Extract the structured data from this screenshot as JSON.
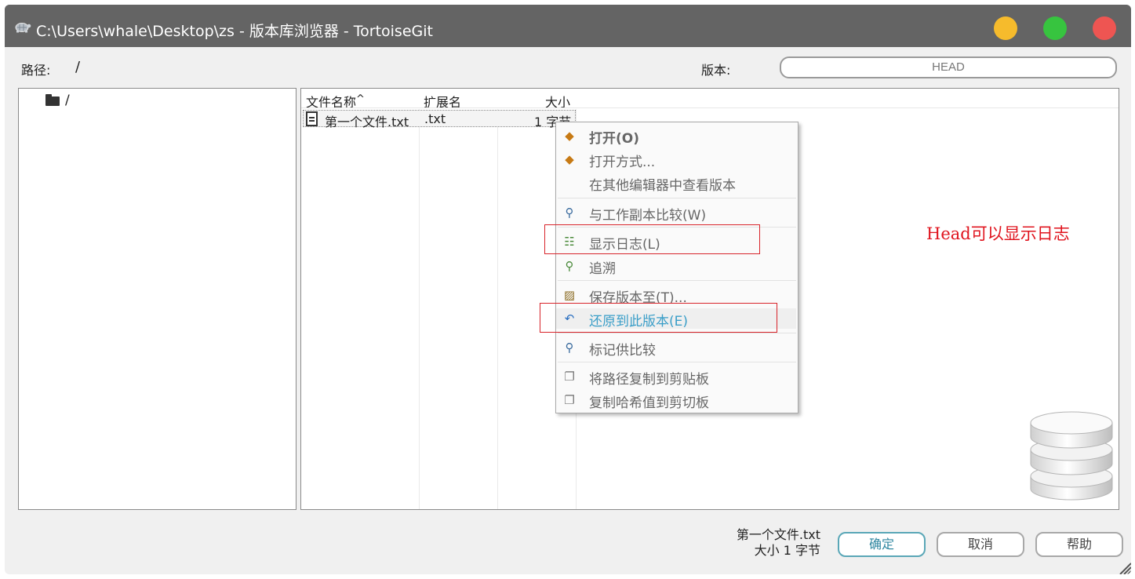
{
  "window": {
    "title": "C:\\Users\\whale\\Desktop\\zs - 版本库浏览器 - TortoiseGit"
  },
  "path_bar": {
    "path_label": "路径:",
    "path_value": "/",
    "version_label": "版本:",
    "version_value": "HEAD"
  },
  "tree": {
    "root_label": "/"
  },
  "file_list": {
    "columns": [
      "文件名称",
      "扩展名",
      "大小"
    ],
    "sort_indicator": "^",
    "rows": [
      {
        "name": "第一个文件.txt",
        "ext": ".txt",
        "size": "1 字节"
      }
    ]
  },
  "context_menu": {
    "items": [
      {
        "label": "打开(O)",
        "icon": "open-folder-icon"
      },
      {
        "label": "打开方式...",
        "icon": "open-with-icon"
      },
      {
        "label": "在其他编辑器中查看版本",
        "icon": ""
      },
      {
        "label": "与工作副本比较(W)",
        "icon": "compare-magnifier-icon"
      },
      {
        "label": "显示日志(L)",
        "icon": "show-log-icon"
      },
      {
        "label": "追溯",
        "icon": "blame-icon"
      },
      {
        "label": "保存版本至(T)...",
        "icon": "save-revision-icon"
      },
      {
        "label": "还原到此版本(E)",
        "icon": "revert-icon"
      },
      {
        "label": "标记供比较",
        "icon": "mark-compare-icon"
      },
      {
        "label": "将路径复制到剪贴板",
        "icon": "copy-path-icon"
      },
      {
        "label": "复制哈希值到剪切板",
        "icon": "copy-hash-icon"
      }
    ]
  },
  "annotation": {
    "text": "Head可以显示日志",
    "color": "#e0141e"
  },
  "status": {
    "line1": "第一个文件.txt",
    "line2": "大小 1 字节"
  },
  "buttons": {
    "ok": "确定",
    "cancel": "取消",
    "help": "帮助"
  },
  "colors": {
    "titlebar": "#646464",
    "traffic_min": "#f6bb2c",
    "traffic_max": "#37c43f",
    "traffic_close": "#ee5552",
    "highlight_box": "#d8232a"
  }
}
